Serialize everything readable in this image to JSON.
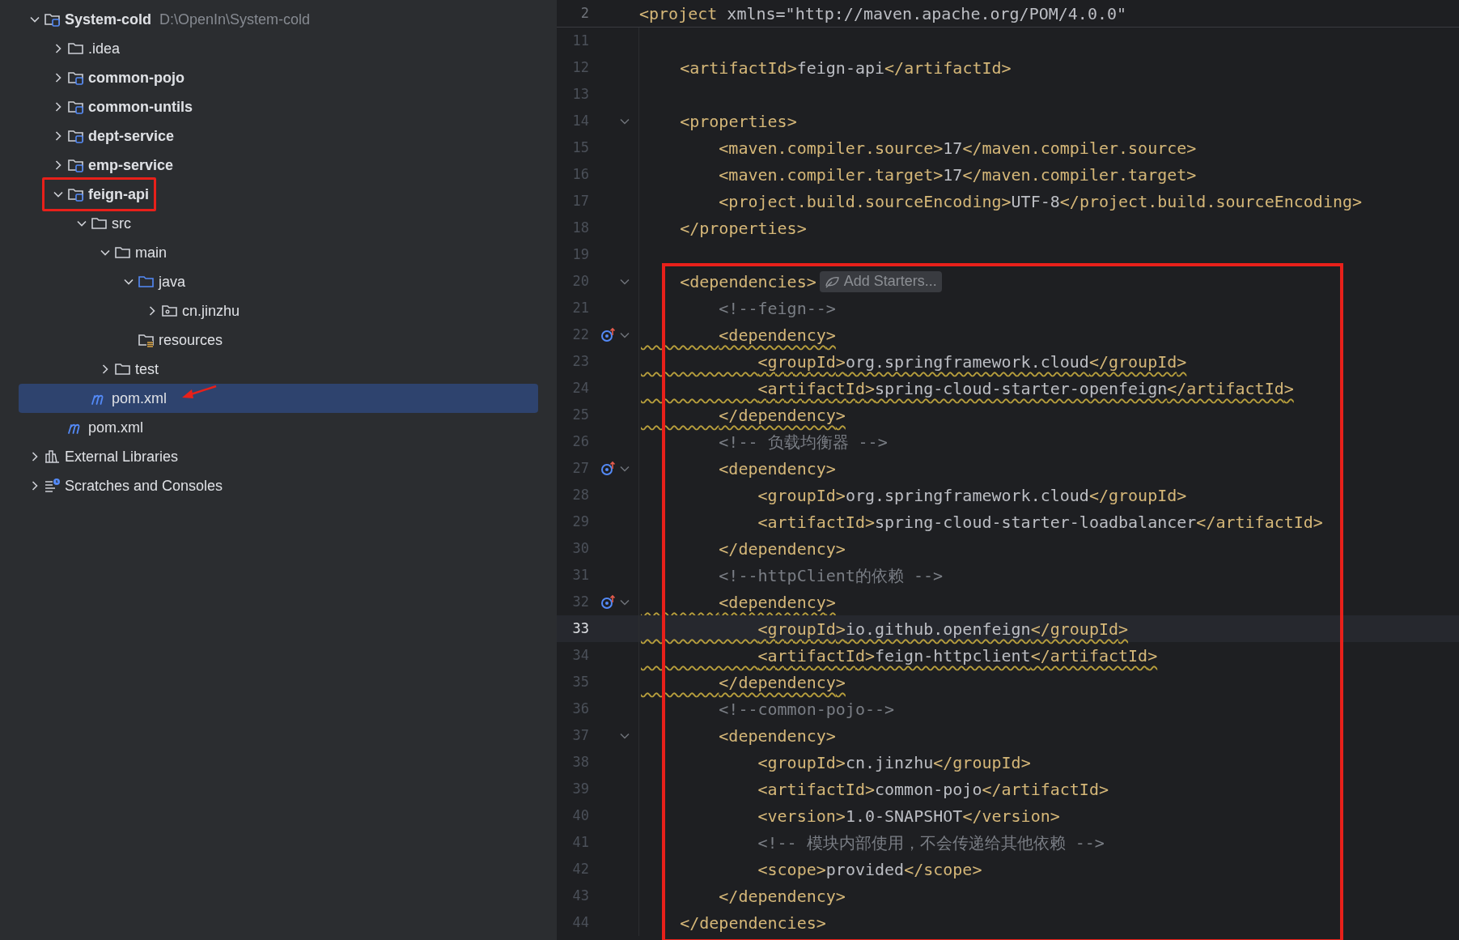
{
  "project_tree": [
    {
      "label": "System-cold",
      "path": "D:\\OpenIn\\System-cold",
      "kind": "module",
      "expanded": true,
      "selected": false,
      "boxed": false,
      "arrow": false,
      "children": [
        {
          "label": ".idea",
          "kind": "folder",
          "expanded": false,
          "selected": false,
          "boxed": false,
          "arrow": false
        },
        {
          "label": "common-pojo",
          "kind": "module",
          "expanded": false,
          "selected": false,
          "boxed": false,
          "arrow": false
        },
        {
          "label": "common-untils",
          "kind": "module",
          "expanded": false,
          "selected": false,
          "boxed": false,
          "arrow": false
        },
        {
          "label": "dept-service",
          "kind": "module",
          "expanded": false,
          "selected": false,
          "boxed": false,
          "arrow": false
        },
        {
          "label": "emp-service",
          "kind": "module",
          "expanded": false,
          "selected": false,
          "boxed": false,
          "arrow": false
        },
        {
          "label": "feign-api",
          "kind": "module",
          "expanded": true,
          "selected": false,
          "boxed": true,
          "arrow": false,
          "children": [
            {
              "label": "src",
              "kind": "folder",
              "expanded": true,
              "selected": false,
              "boxed": false,
              "arrow": false,
              "children": [
                {
                  "label": "main",
                  "kind": "folder",
                  "expanded": true,
                  "selected": false,
                  "boxed": false,
                  "arrow": false,
                  "children": [
                    {
                      "label": "java",
                      "kind": "source-folder",
                      "expanded": true,
                      "selected": false,
                      "boxed": false,
                      "arrow": false,
                      "children": [
                        {
                          "label": "cn.jinzhu",
                          "kind": "package",
                          "expanded": false,
                          "selected": false,
                          "boxed": false,
                          "arrow": false
                        }
                      ]
                    },
                    {
                      "label": "resources",
                      "kind": "resources",
                      "selected": false,
                      "boxed": false,
                      "arrow": false
                    }
                  ]
                },
                {
                  "label": "test",
                  "kind": "folder",
                  "expanded": false,
                  "selected": false,
                  "boxed": false,
                  "arrow": false
                }
              ]
            },
            {
              "label": "pom.xml",
              "kind": "maven",
              "selected": true,
              "boxed": false,
              "arrow": true
            }
          ]
        },
        {
          "label": "pom.xml",
          "kind": "maven",
          "selected": false,
          "boxed": false,
          "arrow": false
        }
      ]
    },
    {
      "label": "External Libraries",
      "kind": "libraries",
      "expanded": false,
      "selected": false,
      "boxed": false,
      "arrow": false
    },
    {
      "label": "Scratches and Consoles",
      "kind": "scratches",
      "expanded": false,
      "selected": false,
      "boxed": false,
      "arrow": false
    }
  ],
  "editor": {
    "sticky_line": {
      "number": "2",
      "text": "<project xmlns=\"http://maven.apache.org/POM/4.0.0\""
    },
    "lines": [
      {
        "number": "11",
        "fold": false,
        "marker": false,
        "warning": false,
        "current": false,
        "in_box": false
      },
      {
        "number": "12",
        "text": "    <artifactId>feign-api</artifactId>",
        "fold": false,
        "marker": false,
        "warning": false,
        "current": false,
        "in_box": false
      },
      {
        "number": "13",
        "fold": false,
        "marker": false,
        "warning": false,
        "current": false,
        "in_box": false
      },
      {
        "number": "14",
        "text": "    <properties>",
        "fold": true,
        "marker": false,
        "warning": false,
        "current": false,
        "in_box": false
      },
      {
        "number": "15",
        "text": "        <maven.compiler.source>17</maven.compiler.source>",
        "fold": false,
        "marker": false,
        "warning": false,
        "current": false,
        "in_box": false
      },
      {
        "number": "16",
        "text": "        <maven.compiler.target>17</maven.compiler.target>",
        "fold": false,
        "marker": false,
        "warning": false,
        "current": false,
        "in_box": false
      },
      {
        "number": "17",
        "text": "        <project.build.sourceEncoding>UTF-8</project.build.sourceEncoding>",
        "fold": false,
        "marker": false,
        "warning": false,
        "current": false,
        "in_box": false
      },
      {
        "number": "18",
        "text": "    </properties>",
        "fold": false,
        "marker": false,
        "warning": false,
        "current": false,
        "in_box": false
      },
      {
        "number": "19",
        "fold": false,
        "marker": false,
        "warning": false,
        "current": false,
        "in_box": false
      },
      {
        "number": "20",
        "text": "    <dependencies>",
        "hint": "Add Starters...",
        "fold": true,
        "marker": false,
        "warning": false,
        "current": false,
        "in_box": true
      },
      {
        "number": "21",
        "text": "        <!--feign-->",
        "fold": false,
        "marker": false,
        "warning": false,
        "current": false,
        "in_box": true
      },
      {
        "number": "22",
        "text": "        <dependency>",
        "fold": true,
        "marker": true,
        "warning": true,
        "current": false,
        "in_box": true
      },
      {
        "number": "23",
        "text": "            <groupId>org.springframework.cloud</groupId>",
        "fold": false,
        "marker": false,
        "warning": true,
        "current": false,
        "in_box": true
      },
      {
        "number": "24",
        "text": "            <artifactId>spring-cloud-starter-openfeign</artifactId>",
        "fold": false,
        "marker": false,
        "warning": true,
        "current": false,
        "in_box": true
      },
      {
        "number": "25",
        "text": "        </dependency>",
        "fold": false,
        "marker": false,
        "warning": true,
        "current": false,
        "in_box": true
      },
      {
        "number": "26",
        "text": "        <!-- 负载均衡器 -->",
        "fold": false,
        "marker": false,
        "warning": false,
        "current": false,
        "in_box": true
      },
      {
        "number": "27",
        "text": "        <dependency>",
        "fold": true,
        "marker": true,
        "warning": false,
        "current": false,
        "in_box": true
      },
      {
        "number": "28",
        "text": "            <groupId>org.springframework.cloud</groupId>",
        "fold": false,
        "marker": false,
        "warning": false,
        "current": false,
        "in_box": true
      },
      {
        "number": "29",
        "text": "            <artifactId>spring-cloud-starter-loadbalancer</artifactId>",
        "fold": false,
        "marker": false,
        "warning": false,
        "current": false,
        "in_box": true
      },
      {
        "number": "30",
        "text": "        </dependency>",
        "fold": false,
        "marker": false,
        "warning": false,
        "current": false,
        "in_box": true
      },
      {
        "number": "31",
        "text": "        <!--httpClient的依赖 -->",
        "fold": false,
        "marker": false,
        "warning": false,
        "current": false,
        "in_box": true
      },
      {
        "number": "32",
        "text": "        <dependency>",
        "fold": true,
        "marker": true,
        "warning": true,
        "current": false,
        "in_box": true
      },
      {
        "number": "33",
        "text": "            <groupId>io.github.openfeign</groupId>",
        "fold": false,
        "marker": false,
        "warning": true,
        "current": true,
        "in_box": true
      },
      {
        "number": "34",
        "text": "            <artifactId>feign-httpclient</artifactId>",
        "fold": false,
        "marker": false,
        "warning": true,
        "current": false,
        "in_box": true
      },
      {
        "number": "35",
        "text": "        </dependency>",
        "fold": false,
        "marker": false,
        "warning": true,
        "current": false,
        "in_box": true
      },
      {
        "number": "36",
        "text": "        <!--common-pojo-->",
        "fold": false,
        "marker": false,
        "warning": false,
        "current": false,
        "in_box": true
      },
      {
        "number": "37",
        "text": "        <dependency>",
        "fold": true,
        "marker": false,
        "warning": false,
        "current": false,
        "in_box": true
      },
      {
        "number": "38",
        "text": "            <groupId>cn.jinzhu</groupId>",
        "fold": false,
        "marker": false,
        "warning": false,
        "current": false,
        "in_box": true
      },
      {
        "number": "39",
        "text": "            <artifactId>common-pojo</artifactId>",
        "fold": false,
        "marker": false,
        "warning": false,
        "current": false,
        "in_box": true
      },
      {
        "number": "40",
        "text": "            <version>1.0-SNAPSHOT</version>",
        "fold": false,
        "marker": false,
        "warning": false,
        "current": false,
        "in_box": true
      },
      {
        "number": "41",
        "text": "            <!-- 模块内部使用，不会传递给其他依赖 -->",
        "fold": false,
        "marker": false,
        "warning": false,
        "current": false,
        "in_box": true
      },
      {
        "number": "42",
        "text": "            <scope>provided</scope>",
        "fold": false,
        "marker": false,
        "warning": false,
        "current": false,
        "in_box": true
      },
      {
        "number": "43",
        "text": "        </dependency>",
        "fold": false,
        "marker": false,
        "warning": false,
        "current": false,
        "in_box": true
      },
      {
        "number": "44",
        "text": "    </dependencies>",
        "fold": false,
        "marker": false,
        "warning": false,
        "current": false,
        "in_box": true
      }
    ]
  }
}
